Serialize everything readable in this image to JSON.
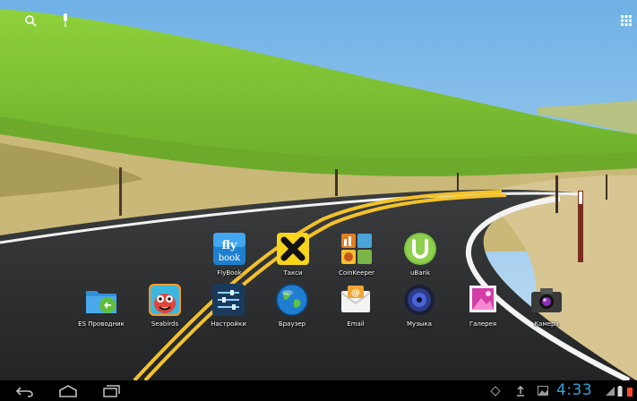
{
  "topbar": {
    "search_icon": "search-icon",
    "voice_icon": "microphone-icon",
    "apps_icon": "all-apps-grid-icon"
  },
  "apps": [
    {
      "label": "FlyBook",
      "icon": "flybook-icon"
    },
    {
      "label": "Такси",
      "icon": "taxi-icon"
    },
    {
      "label": "CoinKeeper",
      "icon": "coinkeeper-icon"
    },
    {
      "label": "uBank",
      "icon": "ubank-icon"
    },
    {
      "label": "ES Проводник",
      "icon": "es-explorer-icon"
    },
    {
      "label": "Seabirds",
      "icon": "seabirds-icon"
    },
    {
      "label": "Настройки",
      "icon": "settings-icon"
    },
    {
      "label": "Браузер",
      "icon": "browser-globe-icon"
    },
    {
      "label": "Email",
      "icon": "email-icon"
    },
    {
      "label": "Музыка",
      "icon": "music-speaker-icon"
    },
    {
      "label": "Галерея",
      "icon": "gallery-icon"
    },
    {
      "label": "Камера",
      "icon": "camera-icon"
    }
  ],
  "navbar": {
    "back": "back-icon",
    "home": "home-icon",
    "recents": "recent-apps-icon",
    "status_icons": [
      "usb-icon",
      "upload-icon",
      "image-icon"
    ],
    "clock": "4:33",
    "clock_color": "#2ea3d9"
  },
  "colors": {
    "sky": "#8ec6ec",
    "grass": "#6fb82e",
    "road": "#2c2e30",
    "road_line": "#f2c22a"
  }
}
